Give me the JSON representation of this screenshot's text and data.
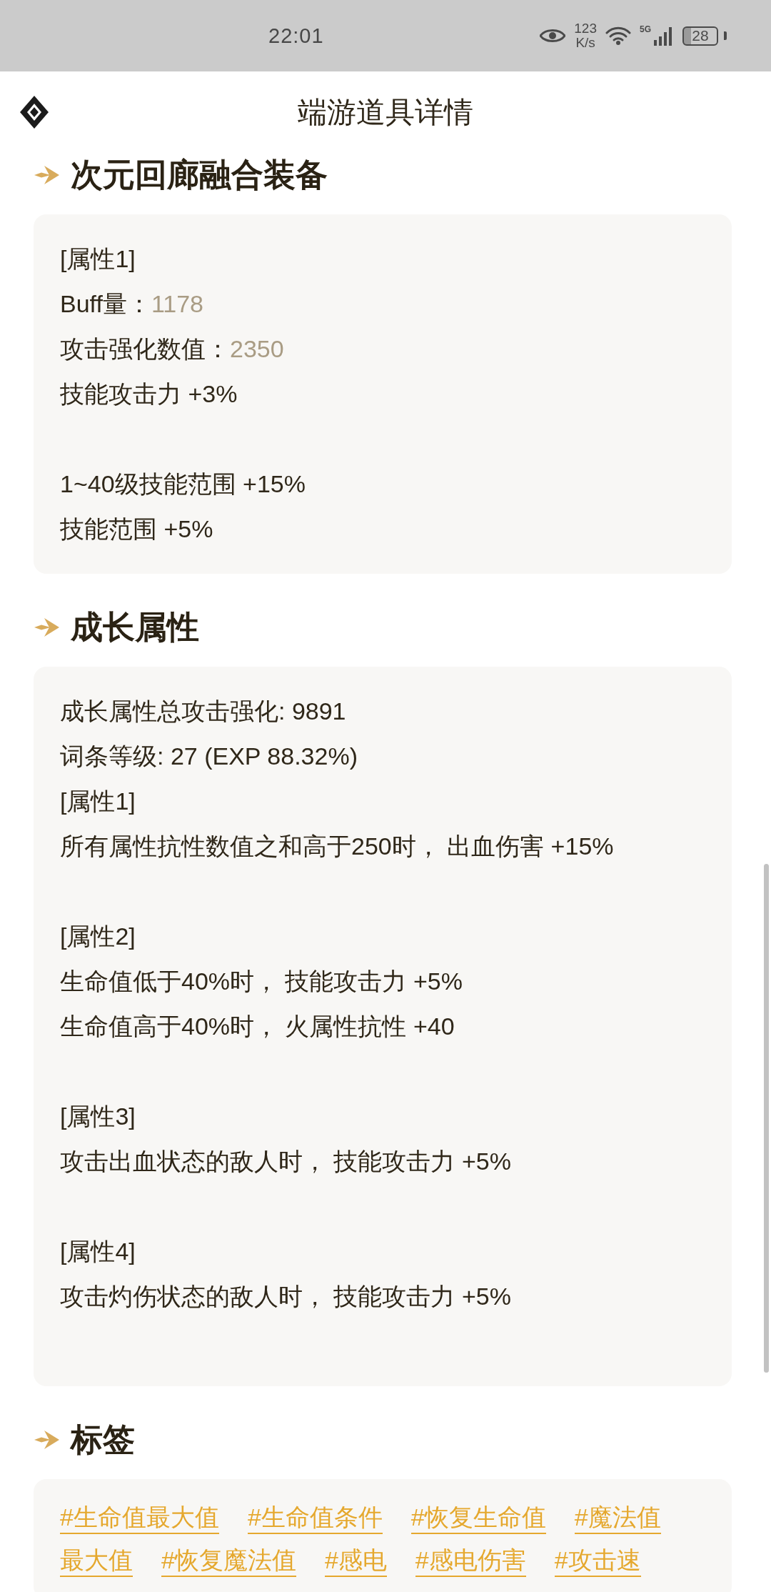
{
  "status_bar": {
    "time": "22:01",
    "speed_value": "123",
    "speed_unit": "K/s",
    "network": "5G",
    "battery": "28"
  },
  "header": {
    "title": "端游道具详情"
  },
  "sections": [
    {
      "kind": "lines",
      "title": "次元回廊融合装备",
      "lines": [
        {
          "kind": "text",
          "text": "[属性1]"
        },
        {
          "kind": "stat",
          "label": "Buff量：",
          "value": "1178"
        },
        {
          "kind": "stat",
          "label": "攻击强化数值：",
          "value": "2350"
        },
        {
          "kind": "text",
          "text": "技能攻击力 +3%"
        },
        {
          "kind": "gap"
        },
        {
          "kind": "text",
          "text": "1~40级技能范围 +15%"
        },
        {
          "kind": "text",
          "text": "技能范围 +5%"
        }
      ]
    },
    {
      "kind": "lines",
      "title": "成长属性",
      "lines": [
        {
          "kind": "text",
          "text": "成长属性总攻击强化: 9891"
        },
        {
          "kind": "text",
          "text": "词条等级: 27 (EXP 88.32%)"
        },
        {
          "kind": "text",
          "text": "[属性1]"
        },
        {
          "kind": "text",
          "text": "所有属性抗性数值之和高于250时， 出血伤害 +15%"
        },
        {
          "kind": "gap"
        },
        {
          "kind": "text",
          "text": "[属性2]"
        },
        {
          "kind": "text",
          "text": "生命值低于40%时， 技能攻击力 +5%"
        },
        {
          "kind": "text",
          "text": "生命值高于40%时， 火属性抗性 +40"
        },
        {
          "kind": "gap"
        },
        {
          "kind": "text",
          "text": "[属性3]"
        },
        {
          "kind": "text",
          "text": "攻击出血状态的敌人时， 技能攻击力 +5%"
        },
        {
          "kind": "gap"
        },
        {
          "kind": "text",
          "text": "[属性4]"
        },
        {
          "kind": "text",
          "text": "攻击灼伤状态的敌人时， 技能攻击力 +5%"
        },
        {
          "kind": "gap"
        }
      ]
    },
    {
      "kind": "tags",
      "title": "标签",
      "tags": [
        "#生命值最大值",
        "#生命值条件",
        "#恢复生命值",
        "#魔法值",
        "最大值",
        "#恢复魔法值",
        "#感电",
        "#感电伤害",
        "#攻击速"
      ]
    }
  ]
}
